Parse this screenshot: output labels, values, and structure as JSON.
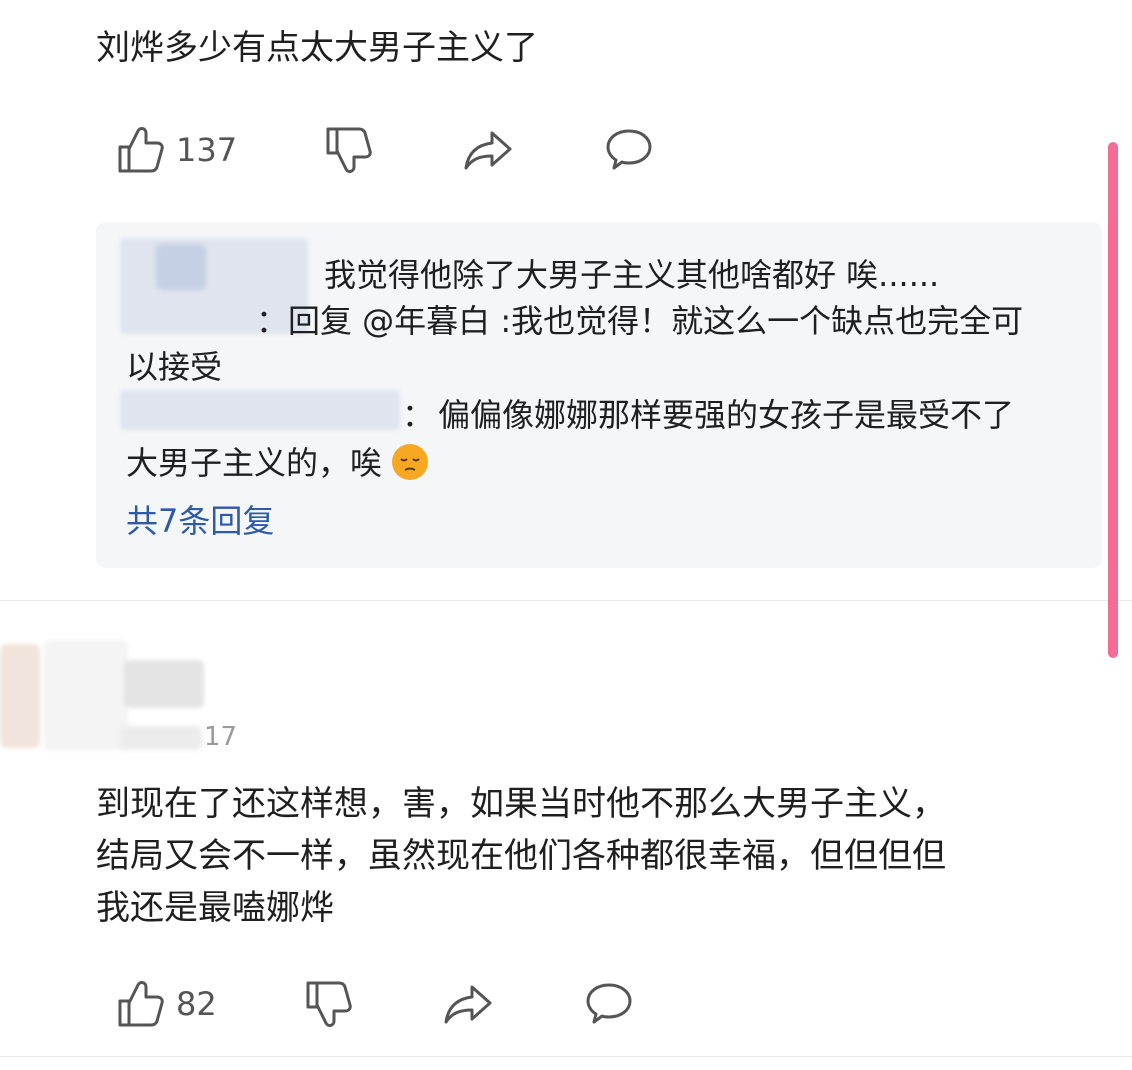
{
  "comment1": {
    "text": "刘烨多少有点太大男子主义了",
    "like_count": "137",
    "icons": [
      "thumbs-up-icon",
      "thumbs-down-icon",
      "share-icon",
      "comment-icon"
    ]
  },
  "replies": {
    "line1": "我觉得他除了大男子主义其他啥都好 唉......",
    "reply2_sep": "：",
    "reply2_text": "回复 @年暮白 :我也觉得！就这么一个缺点也完全可",
    "reply2_cont": "以接受",
    "reply3_sep": "：",
    "reply3_text": "偏偏像娜娜那样要强的女孩子是最受不了",
    "reply3_cont": "大男子主义的，唉",
    "more": "共7条回复"
  },
  "comment2": {
    "timestamp": "17",
    "line1": "到现在了还这样想，害，如果当时他不那么大男子主义，",
    "line2": "结局又会不一样，虽然现在他们各种都很幸福，但但但但",
    "line3": "我还是最嗑娜烨",
    "like_count": "82"
  },
  "colors": {
    "scrollbar": "#f46c93",
    "link": "#2d5aa8",
    "reply_bg": "#f5f6f8"
  }
}
